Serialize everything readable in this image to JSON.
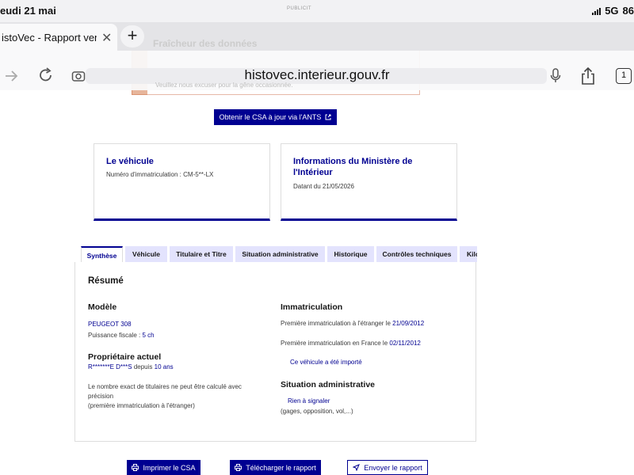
{
  "statusbar": {
    "date": "eudi 21 mai",
    "center": "PUBLICIT",
    "network": "5G",
    "battery": "86"
  },
  "browser": {
    "tab_title": "istoVec - Rapport vend",
    "tab_close": "✕",
    "new_tab": "+",
    "url": "histovec.interieur.gouv.fr",
    "tab_count": "1"
  },
  "ghost": {
    "title": "Fraîcheur des données",
    "text": "Veuillez nous excuser pour la gêne occasionnée."
  },
  "csa_button": {
    "label": "Obtenir le CSA à jour via l'ANTS"
  },
  "cards": {
    "vehicle": {
      "title": "Le véhicule",
      "desc_label": "Numéro d'immatriculation : ",
      "plate": "CM-5**-LX"
    },
    "ministry": {
      "title_line1": "Informations du Ministère de",
      "title_line2": "l'Intérieur",
      "date_text": "Datant du 21/05/2026"
    }
  },
  "tabs": [
    "Synthèse",
    "Véhicule",
    "Titulaire et Titre",
    "Situation administrative",
    "Historique",
    "Contrôles techniques",
    "Kilo"
  ],
  "summary": {
    "heading": "Résumé",
    "modele": {
      "heading": "Modèle",
      "name": "PEUGEOT 308",
      "power_label": "Puissance fiscale : ",
      "power_value": "5 ch"
    },
    "proprietaire": {
      "heading": "Propriétaire actuel",
      "owner": "R*******E D***S",
      "since_label": " depuis ",
      "since_value": "10 ans",
      "note_line1": "Le nombre exact de titulaires ne peut être calculé avec",
      "note_line2": "précision",
      "note_line3": "(première immatriculation à l'étranger)"
    },
    "immatriculation": {
      "heading": "Immatriculation",
      "foreign_label": "Première immatriculation à l'étranger le ",
      "foreign_date": "21/09/2012",
      "france_label": "Première immatriculation en France le ",
      "france_date": "02/11/2012",
      "imported": "Ce véhicule a été importé"
    },
    "situation": {
      "heading": "Situation administrative",
      "status": "Rien à signaler",
      "details": "(gages, opposition, vol,...)"
    }
  },
  "actions": {
    "print": "Imprimer le CSA",
    "download": "Télécharger le rapport",
    "send": "Envoyer le rapport"
  },
  "colors": {
    "primary": "#000091",
    "tab_bg": "#e3e3fd",
    "alert": "#d06d3a"
  }
}
